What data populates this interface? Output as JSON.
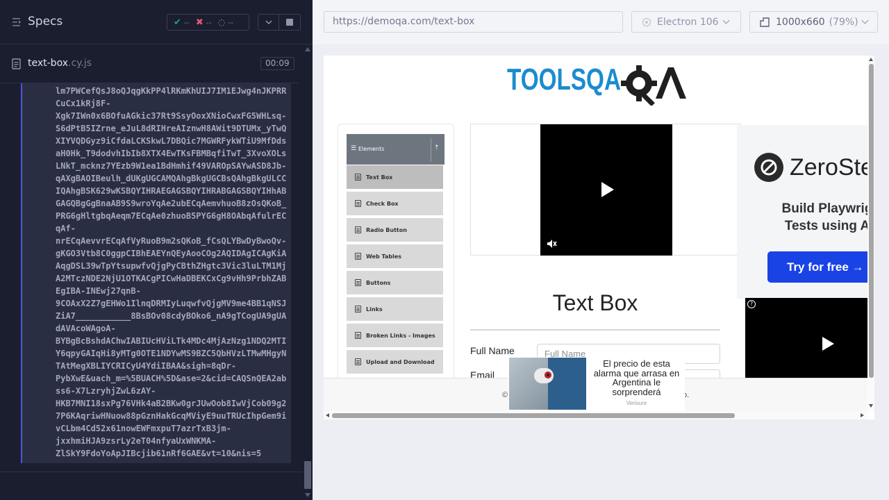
{
  "runner": {
    "specs_title": "Specs",
    "stats": {
      "passed": "--",
      "failed": "--",
      "pending": "--"
    },
    "spec_file": {
      "name": "text-box",
      "ext": ".cy.js",
      "duration": "00:09"
    },
    "log_text": "lm7PWCefQsJ8oQJqgKkPP4lRKmKhUIJ7IM1EJwg4nJKPRR\nCuCx1kRj8F-\nXgk7IWn0x6BOfuAGkic37Rt9SsyOoxXNioCwxFG5WHLsq-\nS6dPtB5IZrne_eJuL8dRIHreAIznwH8AWit9DTUMx_yTwQ\nXIYVQDGyz9iCfdaLCKSkwL7DBQic7MGWRFykWTiU9MfDds\naH0Hk_T9dodvhIbIb8XTX4EwTKsFBMBqfiTwT_3XvoXOLs\nLNkT_mcknz7YEzb9W1ea1BdHmhif49VAROpSAYwASD8Jb-\nqAXgBAOIBeulh_dUKgUGCAMQAhgBkgUGCBsQAhgBkgULCC\nIQAhgBSK629wKSBQYIHRAEGAGSBQYIHRABGAGSBQYIHhAB\nGAGQBgGgBnaAB9S9wroYqAe2ubECqAemvhuoB8zOsQKoB_\nPRG6gHltgbqAeqm7ECqAe0zhuoB5PYG6gH8OAbqAfulrEC\nqAf-\nnrECqAevvrECqAfVyRuoB9m2sQKoB_fCsQLYBwDyBwoQv-\ngKGO3Vtb8C0ggpCIBhEAEYnQEyAooCOg2AQIDAgICAgKiA\nAqgDSL39wTpYtsupwfvQjgPyCBthZHgtc3Vic3luLTM1Mj\nA2MTczNDE2NjU1OTKACgPICwHaDBEKCxCg9vHh9PrbhZAB\nEgIBA-INEwj27qnB-\n9COAxX2Z7gEHWo1IlnqDRMIyLuqwfvQjgMV9me4BB1qNSJ\nZiA7___________8BsBOv08cdyBOko6_nA9gTCogUA9gUA\ndAVAcoWAgoA-\nBYBgBcBshdAChwIABIUcHViLTk4MDc4MjAzNzg1NDQ2MTI\nY6qpyGAIqHi8yMTg0OTE1NDYwMS9BZC5QbHVzLTMwMHgyN\nTAtMegXBLIYCRICyU4YdiIBAA&sigh=8qDr-\nPybXwE&uach_m=%5BUACH%5D&ase=2&cid=CAQSnQEA2ab\nss6-X7LzryhjZwL6zAY-\nHKB7MNI18sxPg76VHk4aB2BKw0grJUwOob8IwVjCob09g2\n7P6KAqriwHNuow88pGznHakGcqMViyE9uuTRUcIhpGem9i\nvCLbm4Cd52x61nowEWFmxpuT7azrTxB3jm-\njxxhmiHJA9zsrLy2eT04nfyaUxWNKMA-\nZlSkY9FdoYoApJIBcjib61nRf6GAE&vt=10&nis=5"
  },
  "aut": {
    "url": "https://demoqa.com/text-box",
    "browser": "Electron 106",
    "viewport": "1000x660",
    "zoom": "(79%)",
    "logo_text": "TOOLSQA",
    "sidebar": {
      "group": "Elements",
      "items": [
        "Text Box",
        "Check Box",
        "Radio Button",
        "Web Tables",
        "Buttons",
        "Links",
        "Broken Links - Images",
        "Upload and Download"
      ]
    },
    "page_title": "Text Box",
    "form": {
      "full_name_label": "Full Name",
      "full_name_placeholder": "Full Name",
      "email_label": "Email"
    },
    "ad_right": {
      "brand": "ZeroSte",
      "headline_line1": "Build Playwrig",
      "headline_line2": "Tests using A",
      "cta": "Try for free →"
    },
    "ad_bottom": {
      "text": "El precio de esta alarma que arrasa en Argentina le sorprenderá",
      "source": "Verisure"
    },
    "footer": {
      "left": "©",
      "right": "o."
    },
    "colors": {
      "accent": "#4956e3",
      "cta_blue": "#1a43e6",
      "logo_blue": "#1b8ccf"
    }
  }
}
